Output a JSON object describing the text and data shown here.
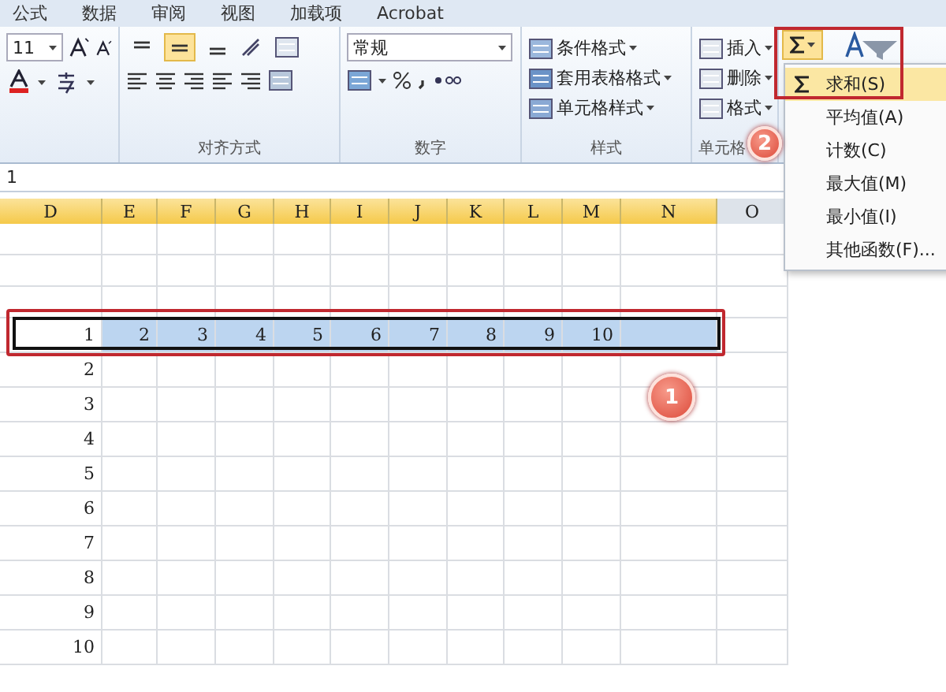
{
  "menu_tabs": [
    "公式",
    "数据",
    "审阅",
    "视图",
    "加载项",
    "Acrobat"
  ],
  "ribbon": {
    "font_group": {
      "font_size": "11"
    },
    "alignment_group": {
      "label": "对齐方式",
      "vertical_align": [
        {
          "selected": false
        },
        {
          "selected": true
        },
        {
          "selected": false
        }
      ]
    },
    "number_group": {
      "format": "常规",
      "label": "数字"
    },
    "styles_group": {
      "buttons": [
        "条件格式",
        "套用表格格式",
        "单元格样式"
      ],
      "label": "样式"
    },
    "cells_group": {
      "buttons": [
        "插入",
        "删除",
        "格式"
      ],
      "label": "单元格"
    }
  },
  "formula_bar": {
    "value": "1"
  },
  "sheet": {
    "columns": [
      {
        "label": "D",
        "selected": true
      },
      {
        "label": "E",
        "selected": true
      },
      {
        "label": "F",
        "selected": true
      },
      {
        "label": "G",
        "selected": true
      },
      {
        "label": "H",
        "selected": true
      },
      {
        "label": "I",
        "selected": true
      },
      {
        "label": "J",
        "selected": true
      },
      {
        "label": "K",
        "selected": true
      },
      {
        "label": "L",
        "selected": true
      },
      {
        "label": "M",
        "selected": true
      },
      {
        "label": "N",
        "selected": true
      },
      {
        "label": "O",
        "selected": false
      }
    ],
    "rows": [
      {
        "values": [
          "1",
          "2",
          "3",
          "4",
          "5",
          "6",
          "7",
          "8",
          "9",
          "10"
        ],
        "selected": true
      },
      {
        "values": [
          "2"
        ],
        "selected": false
      },
      {
        "values": [
          "3"
        ],
        "selected": false
      },
      {
        "values": [
          "4"
        ],
        "selected": false
      },
      {
        "values": [
          "5"
        ],
        "selected": false
      },
      {
        "values": [
          "6"
        ],
        "selected": false
      },
      {
        "values": [
          "7"
        ],
        "selected": false
      },
      {
        "values": [
          "8"
        ],
        "selected": false
      },
      {
        "values": [
          "9"
        ],
        "selected": false
      },
      {
        "values": [
          "10"
        ],
        "selected": false
      }
    ]
  },
  "sum_menu": {
    "items": [
      {
        "label": "求和(S)",
        "selected": true
      },
      {
        "label": "平均值(A)",
        "selected": false
      },
      {
        "label": "计数(C)",
        "selected": false
      },
      {
        "label": "最大值(M)",
        "selected": false
      },
      {
        "label": "最小值(I)",
        "selected": false
      },
      {
        "label": "其他函数(F)...",
        "selected": false
      }
    ]
  },
  "callouts": [
    "1",
    "2"
  ]
}
